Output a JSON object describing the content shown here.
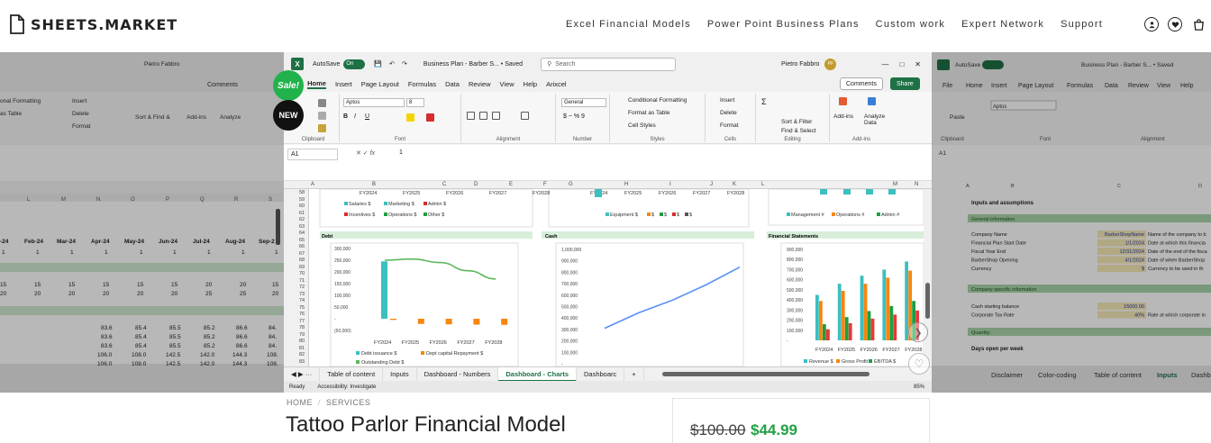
{
  "site": {
    "logo_text": "SHEETS.MARKET",
    "nav": [
      "Excel Financial Models",
      "Power Point Business Plans",
      "Custom work",
      "Expert Network",
      "Support"
    ],
    "icons": [
      "user-icon",
      "heart-icon",
      "cart-icon"
    ]
  },
  "badges": {
    "sale": "Sale!",
    "new": "NEW"
  },
  "excel": {
    "autosave_label": "AutoSave",
    "autosave_state": "On",
    "doc_title": "Business Plan - Barber S... • Saved",
    "search_placeholder": "Search",
    "user": "Pietro Fabbro",
    "user_initials": "PF",
    "menu": [
      "Home",
      "Insert",
      "Page Layout",
      "Formulas",
      "Data",
      "Review",
      "View",
      "Help",
      "Arixcel"
    ],
    "active_menu": "Home",
    "comments_label": "Comments",
    "share_label": "Share",
    "ribbon_groups": [
      "Clipboard",
      "Font",
      "Alignment",
      "Number",
      "Styles",
      "Cells",
      "Editing",
      "Add-ins"
    ],
    "font_name": "Aptos",
    "font_size": "8",
    "number_format": "General",
    "styles_items": [
      "Conditional Formatting",
      "Format as Table",
      "Cell Styles"
    ],
    "cells_items": [
      "Insert",
      "Delete",
      "Format"
    ],
    "editing_items": [
      "Sort & Filter",
      "Find & Select"
    ],
    "addins_items": [
      "Add-ins",
      "Analyze Data"
    ],
    "name_box": "A1",
    "formula_value": "1",
    "columns": [
      "A",
      "B",
      "C",
      "D",
      "E",
      "F",
      "G",
      "H",
      "I",
      "J",
      "K",
      "L",
      "M",
      "N"
    ],
    "rows": [
      "58",
      "59",
      "60",
      "61",
      "62",
      "63",
      "64",
      "65",
      "66",
      "67",
      "68",
      "69",
      "70",
      "71",
      "72",
      "73",
      "74",
      "75",
      "76",
      "77",
      "78",
      "79",
      "80",
      "81",
      "82",
      "83"
    ],
    "sheet_tabs": [
      "Table of content",
      "Inputs",
      "Dashboard - Numbers",
      "Dashboard - Charts",
      "Dashboarc"
    ],
    "active_tab": "Dashboard - Charts",
    "status_ready": "Ready",
    "status_accessibility": "Accessibility: Investigate",
    "zoom": "85%",
    "section_headers": [
      "Debt",
      "Cash",
      "Financial Statements"
    ]
  },
  "left_panel": {
    "months": [
      "Jan-24",
      "Feb-24",
      "Mar-24",
      "Apr-24",
      "May-24",
      "Jun-24",
      "Jul-24",
      "Aug-24",
      "Sep-2"
    ],
    "columns": [
      "L",
      "M",
      "N",
      "O",
      "P",
      "Q",
      "R",
      "S",
      "T"
    ]
  },
  "right_panel": {
    "tabs": [
      "Disclaimer",
      "Color-coding",
      "Table of content",
      "Inputs",
      "Dashb"
    ],
    "heading": "Inputs and assumptions",
    "section_general": "General information",
    "rows": [
      "Company Name",
      "Financial Plan Start Date",
      "Fiscal Year End",
      "BarberShop Opening",
      "Currency"
    ],
    "values": [
      "BarberShopName",
      "1/1/2024",
      "12/31/2024",
      "4/1/2024",
      "$"
    ],
    "notes": [
      "Name of the company to b",
      "Date at which this financia",
      "Date of the end of the fisca",
      "Date of when BarberShop",
      "Currency to be used in th"
    ],
    "section_specific": "Company-specific information",
    "rows2": [
      "Cash starting balance",
      "Corporate Tax Rate"
    ],
    "values2": [
      "15000.00",
      "40%"
    ],
    "notes2": [
      "",
      "Rate at which corporate in"
    ],
    "section_quantity": "Quantity",
    "days_label": "Days open per week"
  },
  "breadcrumb": {
    "home": "HOME",
    "sep": "/",
    "current": "SERVICES"
  },
  "product": {
    "title": "Tattoo Parlor Financial Model",
    "old_price": "$100.00",
    "new_price": "$44.99"
  },
  "chart_data": [
    {
      "type": "bar",
      "title": "Debt",
      "categories": [
        "FY2024",
        "FY2025",
        "FY2026",
        "FY2027",
        "FY2028"
      ],
      "ylim": [
        -50000,
        300000
      ],
      "yticks": [
        "300,000",
        "250,000",
        "200,000",
        "150,000",
        "100,000",
        "50,000",
        "-",
        "(50,000)"
      ],
      "series": [
        {
          "name": "Debt issuance $",
          "kind": "bar",
          "color": "#3bbfc0",
          "values": [
            245000,
            0,
            0,
            0,
            0
          ]
        },
        {
          "name": "Dept capital Repayment $",
          "kind": "bar",
          "color": "#f7860f",
          "values": [
            -5000,
            -22000,
            -24000,
            -25000,
            -26000
          ]
        },
        {
          "name": "Outstanding Debt $",
          "kind": "line",
          "color": "#5cb85c",
          "values": [
            250000,
            255000,
            240000,
            205000,
            170000
          ]
        }
      ]
    },
    {
      "type": "line",
      "title": "Cash",
      "ylim": [
        0,
        1000000
      ],
      "yticks": [
        "1,000,000",
        "900,000",
        "800,000",
        "700,000",
        "600,000",
        "500,000",
        "400,000",
        "300,000",
        "200,000",
        "100,000",
        "-"
      ],
      "series": [
        {
          "name": "",
          "color": "#5b8ff9",
          "values": [
            310000,
            445000,
            555000,
            690000,
            845000
          ]
        }
      ]
    },
    {
      "type": "bar",
      "title": "Financial Statements",
      "categories": [
        "FY2024",
        "FY2025",
        "FY2026",
        "FY2027",
        "FY2028"
      ],
      "ylim": [
        0,
        900000
      ],
      "yticks": [
        "900,000",
        "800,000",
        "700,000",
        "600,000",
        "500,000",
        "400,000",
        "300,000",
        "200,000",
        "100,000",
        "-"
      ],
      "series": [
        {
          "name": "Revenue $",
          "color": "#3bbfc0",
          "values": [
            450000,
            560000,
            640000,
            700000,
            780000
          ]
        },
        {
          "name": "Gross Profit $",
          "color": "#f7860f",
          "values": [
            390000,
            490000,
            560000,
            620000,
            690000
          ]
        },
        {
          "name": "EBITDA $",
          "color": "#1e9e3f",
          "values": [
            160000,
            230000,
            290000,
            340000,
            390000
          ]
        },
        {
          "name": "",
          "color": "#e63939",
          "values": [
            110000,
            170000,
            215000,
            255000,
            295000
          ]
        }
      ]
    }
  ],
  "upper_legends": {
    "left": [
      "Salaries $",
      "Marketing $",
      "Admin $",
      "Incentives $",
      "Operations $",
      "Other $"
    ],
    "middle": [
      "Equipment $",
      "$",
      "$",
      "$",
      "$"
    ],
    "right": [
      "Management #",
      "Operations #",
      "Admin #"
    ],
    "years": [
      "FY2024",
      "FY2025",
      "FY2026",
      "FY2027",
      "FY2028"
    ]
  }
}
